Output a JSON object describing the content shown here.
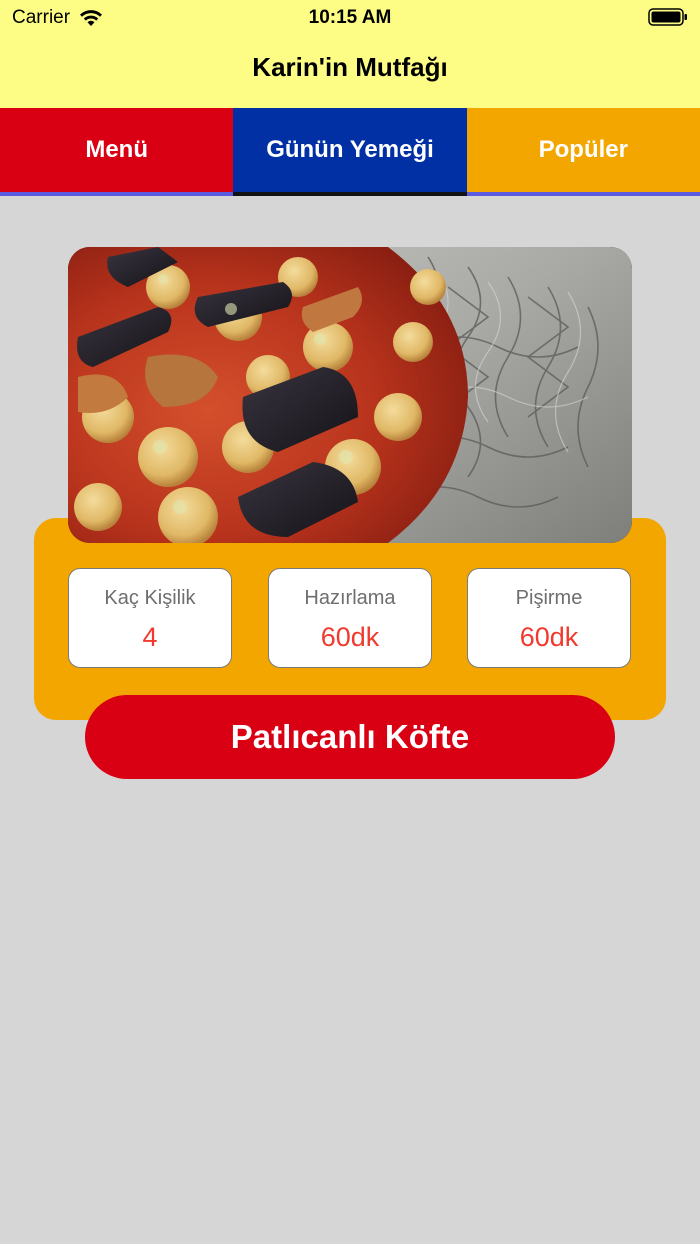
{
  "status_bar": {
    "carrier": "Carrier",
    "time": "10:15 AM"
  },
  "nav": {
    "title": "Karin'in Mutfağı"
  },
  "tabs": [
    {
      "label": "Menü",
      "color": "#da0014"
    },
    {
      "label": "Günün Yemeği",
      "color": "#0130a4"
    },
    {
      "label": "Popüler",
      "color": "#f3a600"
    }
  ],
  "dish": {
    "name": "Patlıcanlı Köfte",
    "image_description": "food-photo",
    "stats": [
      {
        "label": "Kaç Kişilik",
        "value": "4"
      },
      {
        "label": "Hazırlama",
        "value": "60dk"
      },
      {
        "label": "Pişirme",
        "value": "60dk"
      }
    ]
  },
  "colors": {
    "header_background": "#fdfd86",
    "page_background": "#d6d6d6",
    "accent_orange": "#f3a600",
    "accent_red": "#da0014",
    "accent_blue": "#0130a4",
    "value_red": "#f2392e"
  }
}
